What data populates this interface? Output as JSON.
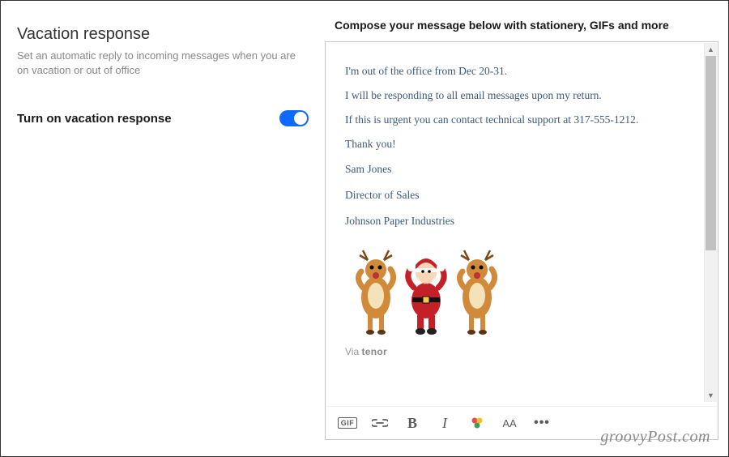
{
  "left": {
    "title": "Vacation response",
    "description": "Set an automatic reply to incoming messages when you are on vacation or out of office",
    "toggle_label": "Turn on vacation response",
    "toggle_on": true
  },
  "right": {
    "heading": "Compose your message below with stationery, GIFs and more",
    "message": {
      "line1": "I'm out of the office from Dec 20-31.",
      "line2": "I will be responding to all email messages upon my return.",
      "line3": "If this is urgent you can contact technical support at 317-555-1212.",
      "line4": "Thank you!"
    },
    "signature": {
      "name": "Sam Jones",
      "title": "Director of Sales",
      "company": "Johnson Paper Industries"
    },
    "gif_attribution_prefix": "Via ",
    "gif_attribution_brand": "tenor",
    "toolbar": {
      "gif": "GIF",
      "bold": "B",
      "italic": "I",
      "textsize": "AA",
      "more": "•••"
    }
  },
  "watermark": "groovyPost.com",
  "icons": {
    "gif_image": "santa-reindeer-dancing"
  }
}
